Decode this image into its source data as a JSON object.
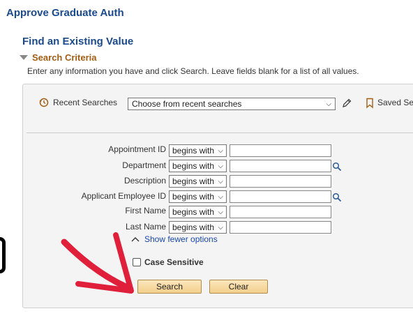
{
  "page": {
    "title": "Approve Graduate Auth"
  },
  "find": {
    "title": "Find an Existing Value"
  },
  "criteria": {
    "header": "Search Criteria",
    "instructions": "Enter any information you have and click Search. Leave fields blank for a list of all values."
  },
  "recent": {
    "label": "Recent Searches",
    "select_value": "Choose from recent searches"
  },
  "saved": {
    "label": "Saved Se"
  },
  "fields": [
    {
      "label": "Appointment ID",
      "operator": "begins with",
      "value": ""
    },
    {
      "label": "Department",
      "operator": "begins with",
      "value": ""
    },
    {
      "label": "Description",
      "operator": "begins with",
      "value": ""
    },
    {
      "label": "Applicant Employee ID",
      "operator": "begins with",
      "value": ""
    },
    {
      "label": "First Name",
      "operator": "begins with",
      "value": ""
    },
    {
      "label": "Last Name",
      "operator": "begins with",
      "value": ""
    }
  ],
  "options": {
    "fewer_label": "Show fewer options",
    "case_sensitive_label": "Case Sensitive"
  },
  "buttons": {
    "search_label": "Search",
    "clear_label": "Clear"
  },
  "colors": {
    "title": "#1a4a8c",
    "criteria": "#a35d13",
    "link": "#1a47b0",
    "annotation_arrow": "#e0203a"
  },
  "icons": {
    "recent": "history-icon",
    "edit": "pencil-icon",
    "saved": "bookmark-icon",
    "lookup": "magnifier-icon",
    "collapse": "chevron-up-icon"
  }
}
